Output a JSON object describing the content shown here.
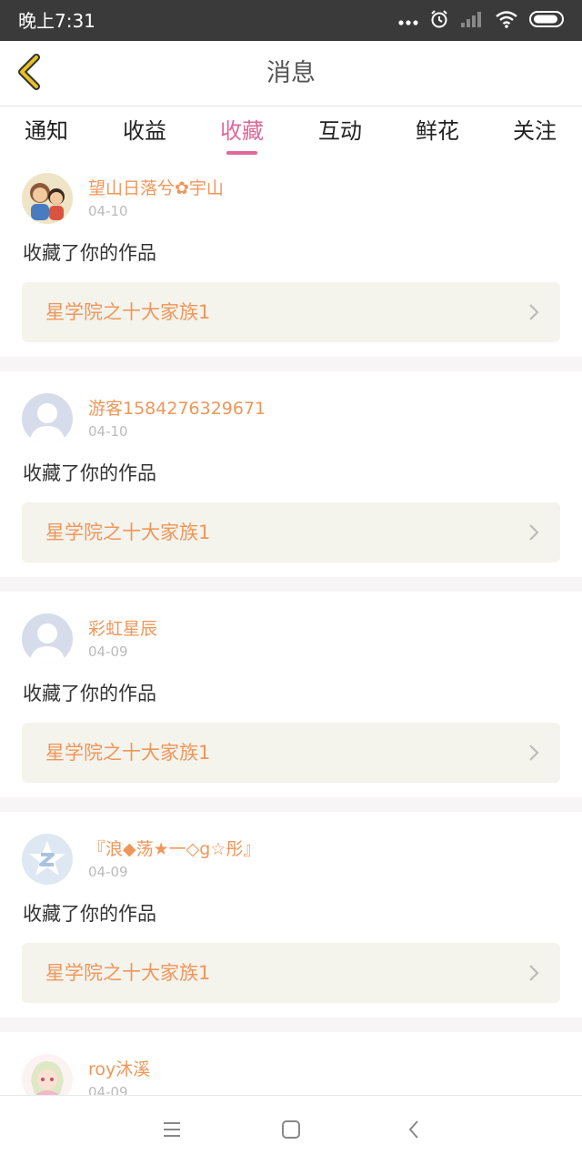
{
  "status_bar": {
    "time": "晚上7:31",
    "icons": [
      "more-dots-icon",
      "alarm-icon",
      "signal-icon",
      "wifi-icon",
      "battery-icon"
    ]
  },
  "header": {
    "title": "消息",
    "back_icon": "chevron-left-icon",
    "accent_color": "#e8c120"
  },
  "tabs": [
    {
      "label": "通知",
      "active": false
    },
    {
      "label": "收益",
      "active": false
    },
    {
      "label": "收藏",
      "active": true
    },
    {
      "label": "互动",
      "active": false
    },
    {
      "label": "鲜花",
      "active": false
    },
    {
      "label": "关注",
      "active": false
    }
  ],
  "theme": {
    "active_tab_color": "#e0679a",
    "username_color": "#f0965a",
    "work_bg": "#f4f3ec"
  },
  "messages": [
    {
      "username": "望山日落兮✿宇山",
      "date": "04-10",
      "action": "收藏了你的作品",
      "work_title": "星学院之十大家族1",
      "avatar": "cartoon-avatar"
    },
    {
      "username": "游客1584276329671",
      "date": "04-10",
      "action": "收藏了你的作品",
      "work_title": "星学院之十大家族1",
      "avatar": "default-user-avatar"
    },
    {
      "username": "彩虹星辰",
      "date": "04-09",
      "action": "收藏了你的作品",
      "work_title": "星学院之十大家族1",
      "avatar": "default-user-avatar"
    },
    {
      "username": "『浪◆荡★一◇g☆彤』",
      "date": "04-09",
      "action": "收藏了你的作品",
      "work_title": "星学院之十大家族1",
      "avatar": "qzone-star-avatar"
    },
    {
      "username": "roy沐溪",
      "date": "04-09",
      "action": "",
      "work_title": "",
      "avatar": "anime-girl-avatar"
    }
  ],
  "nav_bar": {
    "icons": [
      "menu-icon",
      "home-icon",
      "back-icon"
    ]
  }
}
